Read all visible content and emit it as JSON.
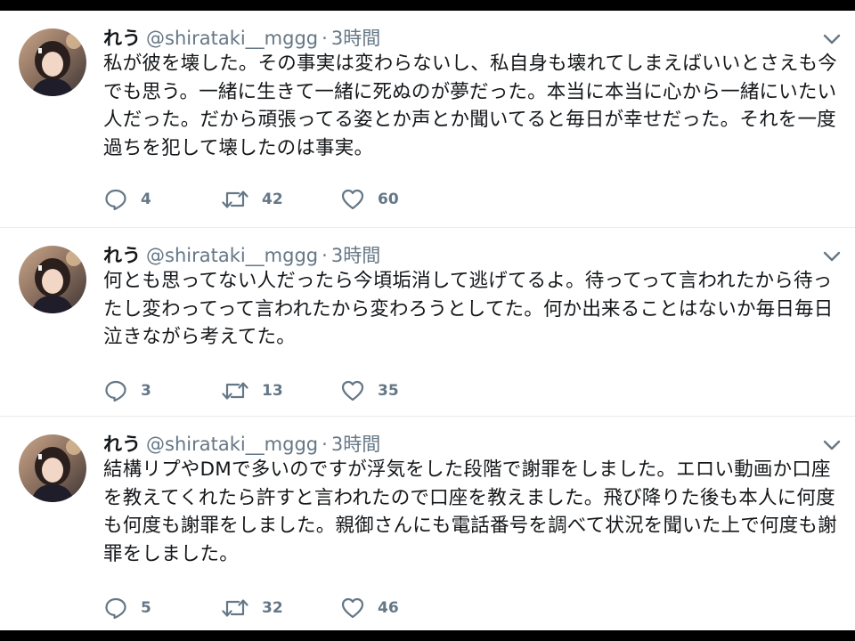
{
  "tweets": [
    {
      "name": "れう",
      "handle": "@shirataki__mggg",
      "separator": "·",
      "time": "3時間",
      "text": "私が彼を壊した。その事実は変わらないし、私自身も壊れてしまえばいいとさえも今でも思う。一緒に生きて一緒に死ぬのが夢だった。本当に本当に心から一緒にいたい人だった。だから頑張ってる姿とか声とか聞いてると毎日が幸せだった。それを一度過ちを犯して壊したのは事実。",
      "replies": "4",
      "retweets": "42",
      "likes": "60"
    },
    {
      "name": "れう",
      "handle": "@shirataki__mggg",
      "separator": "·",
      "time": "3時間",
      "text": "何とも思ってない人だったら今頃垢消して逃げてるよ。待ってって言われたから待ったし変わってって言われたから変わろうとしてた。何か出来ることはないか毎日毎日泣きながら考えてた。",
      "replies": "3",
      "retweets": "13",
      "likes": "35"
    },
    {
      "name": "れう",
      "handle": "@shirataki__mggg",
      "separator": "·",
      "time": "3時間",
      "text": "結構リプやDMで多いのですが浮気をした段階で謝罪をしました。エロい動画か口座を教えてくれたら許すと言われたので口座を教えました。飛び降りた後も本人に何度も何度も謝罪をしました。親御さんにも電話番号を調べて状況を聞いた上で何度も謝罪をしました。",
      "replies": "5",
      "retweets": "32",
      "likes": "46"
    }
  ],
  "icons": {
    "reply": "speech-bubble-icon",
    "retweet": "retweet-arrows-icon",
    "like": "heart-icon",
    "caret": "chevron-down-icon"
  },
  "colors": {
    "text": "#14171a",
    "secondary": "#657786",
    "divider": "#e6ecf0",
    "icon": "#657786"
  }
}
